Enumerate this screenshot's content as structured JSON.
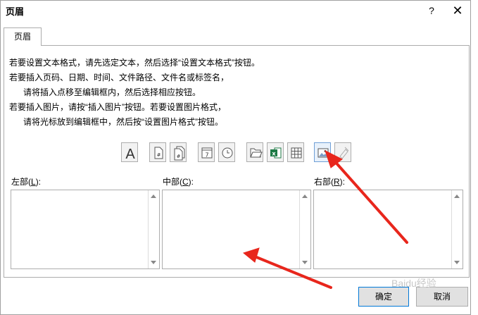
{
  "dialog": {
    "title": "页眉",
    "help_icon": "?",
    "close_icon": "✕"
  },
  "tabs": [
    {
      "label": "页眉",
      "active": true
    }
  ],
  "instructions": [
    "若要设置文本格式，请先选定文本，然后选择“设置文本格式”按钮。",
    "若要插入页码、日期、时间、文件路径、文件名或标签名，",
    "请将插入点移至编辑框内，然后选择相应按钮。",
    "若要插入图片，请按“插入图片”按钮。若要设置图片格式，",
    "请将光标放到编辑框中，然后按“设置图片格式”按钮。"
  ],
  "toolbar": [
    {
      "name": "format-text",
      "icon": "format-text-icon"
    },
    {
      "name": "insert-page-number",
      "icon": "page-number-icon"
    },
    {
      "name": "insert-page-count",
      "icon": "page-count-icon"
    },
    {
      "name": "insert-date",
      "icon": "calendar-icon"
    },
    {
      "name": "insert-time",
      "icon": "clock-icon"
    },
    {
      "name": "insert-file-path",
      "icon": "folder-icon"
    },
    {
      "name": "insert-file-name",
      "icon": "excel-file-icon"
    },
    {
      "name": "insert-sheet-name",
      "icon": "sheet-icon"
    },
    {
      "name": "insert-picture",
      "icon": "picture-icon",
      "highlighted": true
    },
    {
      "name": "format-picture",
      "icon": "format-picture-icon",
      "disabled": true
    }
  ],
  "sections": {
    "left": {
      "label": "左部(",
      "key": "L",
      "suffix": "):",
      "value": ""
    },
    "center": {
      "label": "中部(",
      "key": "C",
      "suffix": "):",
      "value": ""
    },
    "right": {
      "label": "右部(",
      "key": "R",
      "suffix": "):",
      "value": ""
    }
  },
  "buttons": {
    "ok": "确定",
    "cancel": "取消"
  },
  "watermark": "Baidu经验",
  "colors": {
    "annotation_arrow": "#e8261c",
    "accent_border": "#0078d7"
  }
}
